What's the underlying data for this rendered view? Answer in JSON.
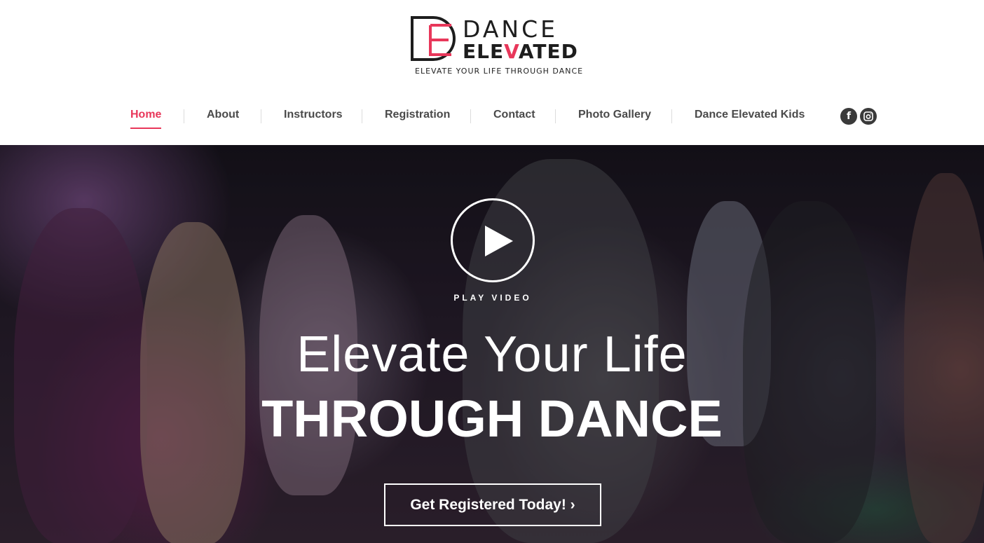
{
  "brand": {
    "word1": "DANCE",
    "word2_part1": "ELE",
    "word2_accent": "V",
    "word2_part2": "ATED",
    "tagline": "ELEVATE YOUR LIFE THROUGH DANCE",
    "accent_color": "#e8375a"
  },
  "nav": {
    "items": [
      {
        "label": "Home",
        "active": true
      },
      {
        "label": "About"
      },
      {
        "label": "Instructors"
      },
      {
        "label": "Registration"
      },
      {
        "label": "Contact"
      },
      {
        "label": "Photo Gallery"
      },
      {
        "label": "Dance Elevated Kids"
      }
    ],
    "social": [
      {
        "icon": "facebook-icon",
        "glyph": "f"
      },
      {
        "icon": "instagram-icon",
        "glyph": ""
      }
    ]
  },
  "hero": {
    "play_label": "PLAY VIDEO",
    "headline_line1": "Elevate Your Life",
    "headline_line2": "THROUGH DANCE",
    "cta_label": "Get Registered Today! ›"
  }
}
